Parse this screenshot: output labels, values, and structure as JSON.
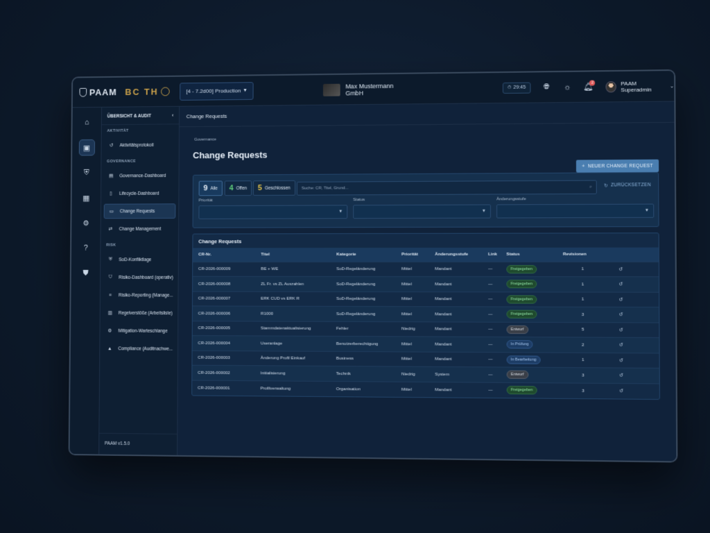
{
  "topbar": {
    "brand1": "PAAM",
    "brand2": "BC TH",
    "environment": "[4 - 7.2d00] Production",
    "company": "Max Mustermann GmbH",
    "clock": "29:45",
    "notifications": "2",
    "user": "PAAM Superadmin"
  },
  "nav": {
    "header": "ÜBERSICHT & AUDIT",
    "sections": [
      {
        "title": "AKTIVITÄT",
        "items": [
          "Aktivitätsprotokoll"
        ]
      },
      {
        "title": "GOVERNANCE",
        "items": [
          "Governance-Dashboard",
          "Lifecycle-Dashboard",
          "Change Requests",
          "Change Management"
        ]
      },
      {
        "title": "RISK",
        "items": [
          "SoD-Konfliktlage",
          "Risiko-Dashboard (operativ)",
          "Risiko-Reporting (Manage...",
          "Regelverstöße (Arbeitsliste)",
          "Mitigation-Warteschlange",
          "Compliance (Auditnachwe..."
        ]
      }
    ],
    "version": "PAAM v1.5.0"
  },
  "main": {
    "header": "Change Requests",
    "breadcrumb": "Governance",
    "title": "Change Requests",
    "new_button": "NEUER CHANGE REQUEST",
    "filters": {
      "all_count": "9",
      "all_label": "Alle",
      "open_count": "4",
      "open_label": "Offen",
      "closed_count": "5",
      "closed_label": "Geschlossen",
      "search_placeholder": "Suche: CR, Titel, Grund...",
      "reset": "ZURÜCKSETZEN",
      "priority_label": "Priorität",
      "status_label": "Status",
      "level_label": "Änderungsstufe"
    },
    "table": {
      "title": "Change Requests",
      "columns": [
        "CR-Nr.",
        "Titel",
        "Kategorie",
        "Priorität",
        "Änderungsstufe",
        "Link",
        "Status",
        "Revisionen",
        ""
      ],
      "rows": [
        {
          "nr": "CR-2026-000009",
          "titel": "BE + WE",
          "kategorie": "SoD-Regeländerung",
          "prio": "Mittel",
          "stufe": "Mandant",
          "link": "—",
          "status": "Freigegeben",
          "rev": "1"
        },
        {
          "nr": "CR-2026-000008",
          "titel": "ZL Fr. vs ZL Auszahlen",
          "kategorie": "SoD-Regeländerung",
          "prio": "Mittel",
          "stufe": "Mandant",
          "link": "—",
          "status": "Freigegeben",
          "rev": "1"
        },
        {
          "nr": "CR-2026-000007",
          "titel": "ERK CUD vs ERK R",
          "kategorie": "SoD-Regeländerung",
          "prio": "Mittel",
          "stufe": "Mandant",
          "link": "—",
          "status": "Freigegeben",
          "rev": "1"
        },
        {
          "nr": "CR-2026-000006",
          "titel": "R1000",
          "kategorie": "SoD-Regeländerung",
          "prio": "Mittel",
          "stufe": "Mandant",
          "link": "—",
          "status": "Freigegeben",
          "rev": "3"
        },
        {
          "nr": "CR-2026-000005",
          "titel": "Stammdatenaktualisierung",
          "kategorie": "Fehler",
          "prio": "Niedrig",
          "stufe": "Mandant",
          "link": "—",
          "status": "Entwurf",
          "rev": "5"
        },
        {
          "nr": "CR-2026-000004",
          "titel": "Useranlage",
          "kategorie": "Benutzerberechtigung",
          "prio": "Mittel",
          "stufe": "Mandant",
          "link": "—",
          "status": "In Prüfung",
          "rev": "2"
        },
        {
          "nr": "CR-2026-000003",
          "titel": "Änderung Profil Einkauf",
          "kategorie": "Business",
          "prio": "Mittel",
          "stufe": "Mandant",
          "link": "—",
          "status": "In Bearbeitung",
          "rev": "1"
        },
        {
          "nr": "CR-2026-000002",
          "titel": "Initialisierung",
          "kategorie": "Technik",
          "prio": "Niedrig",
          "stufe": "System",
          "link": "—",
          "status": "Entwurf",
          "rev": "3"
        },
        {
          "nr": "CR-2026-000001",
          "titel": "Profilverwaltung",
          "kategorie": "Organisation",
          "prio": "Mittel",
          "stufe": "Mandant",
          "link": "—",
          "status": "Freigegeben",
          "rev": "3"
        }
      ]
    }
  },
  "colors": {
    "accent": "#4a7eb0",
    "green": "#5fcb7a",
    "yellow": "#e0c14a",
    "background": "#10223a"
  }
}
